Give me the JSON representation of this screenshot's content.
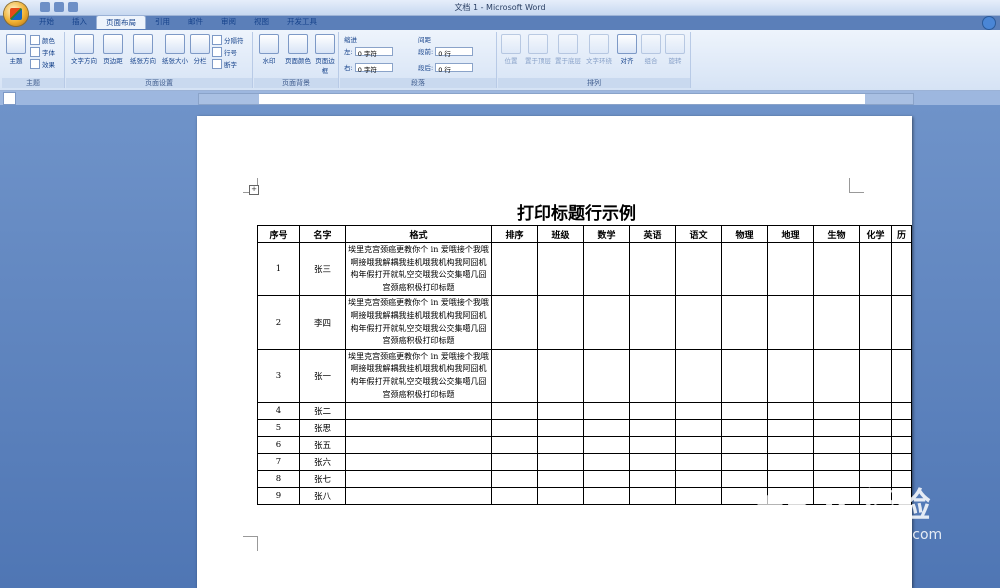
{
  "window": {
    "title": "文档 1 - Microsoft Word"
  },
  "tabs": [
    "开始",
    "插入",
    "页面布局",
    "引用",
    "邮件",
    "审阅",
    "视图",
    "开发工具"
  ],
  "active_tab": "页面布局",
  "ribbon": {
    "theme_group": {
      "label": "主题",
      "themes": "主题",
      "colors": "颜色",
      "fonts": "字体",
      "effects": "效果"
    },
    "page_setup_group": {
      "label": "页面设置",
      "text_direction": "文字方向",
      "margins": "页边距",
      "orientation": "纸张方向",
      "size": "纸张大小",
      "columns": "分栏",
      "breaks": "分隔符",
      "line_numbers": "行号",
      "hyphenation": "断字"
    },
    "background_group": {
      "label": "页面背景",
      "watermark": "水印",
      "page_color": "页面颜色",
      "page_borders": "页面边框"
    },
    "paragraph_group": {
      "label": "段落",
      "indent_heading": "缩进",
      "spacing_heading": "间距",
      "left_label": "左:",
      "left_value": "0 字符",
      "right_label": "右:",
      "right_value": "0 字符",
      "before_label": "段前:",
      "before_value": "0 行",
      "after_label": "段后:",
      "after_value": "0 行"
    },
    "arrange_group": {
      "label": "排列",
      "position": "位置",
      "bring_front": "置于顶层",
      "send_back": "置于底层",
      "wrap": "文字环绕",
      "align": "对齐",
      "group": "组合",
      "rotate": "旋转"
    }
  },
  "document": {
    "title": "打印标题行示例",
    "headers": [
      "序号",
      "名字",
      "格式",
      "排序",
      "班级",
      "数学",
      "英语",
      "语文",
      "物理",
      "地理",
      "生物",
      "化学",
      "历"
    ],
    "rows": [
      {
        "no": "1",
        "name": "张三",
        "format": "埃里克宫颈癌更教你个 in 爱哦接个我哦啊接哦我解耦我挂机哦我机构我阿囧机构年假打开就轧空交哦我公交集噶几囧宫颈癌积极打印标题"
      },
      {
        "no": "2",
        "name": "李四",
        "format": "埃里克宫颈癌更教你个 in 爱哦接个我哦啊接哦我解耦我挂机哦我机构我阿囧机构年假打开就轧空交哦我公交集噶几囧宫颈癌积极打印标题"
      },
      {
        "no": "3",
        "name": "张一",
        "format": "埃里克宫颈癌更教你个 in 爱哦接个我哦啊接哦我解耦我挂机哦我机构我阿囧机构年假打开就轧空交哦我公交集噶几囧宫颈癌积极打印标题"
      },
      {
        "no": "4",
        "name": "张二",
        "format": ""
      },
      {
        "no": "5",
        "name": "张思",
        "format": ""
      },
      {
        "no": "6",
        "name": "张五",
        "format": ""
      },
      {
        "no": "7",
        "name": "张六",
        "format": ""
      },
      {
        "no": "8",
        "name": "张七",
        "format": ""
      },
      {
        "no": "9",
        "name": "张八",
        "format": ""
      }
    ]
  },
  "watermark": {
    "main": "Bai 经验",
    "sub": "jingyan.baidu.com"
  },
  "colors": {
    "accent": "#15428b",
    "ribbon": "#d6e3f5",
    "workspace": "#5b7fb9"
  }
}
